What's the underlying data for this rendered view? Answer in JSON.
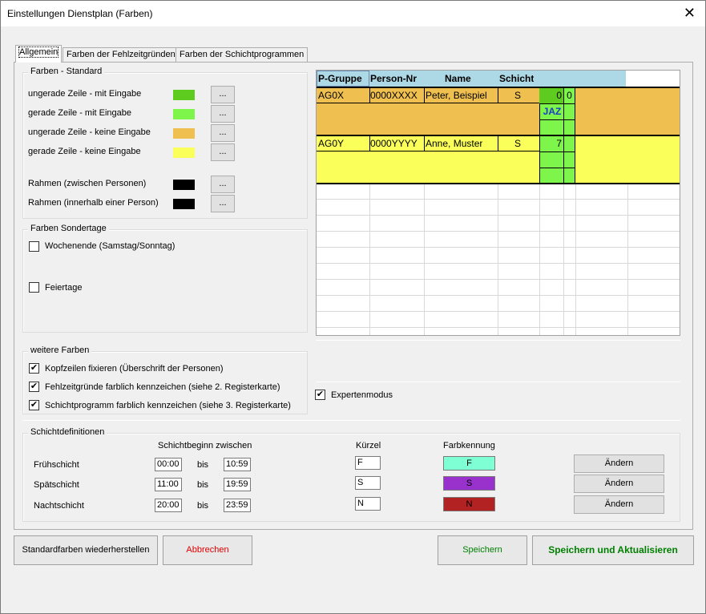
{
  "window": {
    "title": "Einstellungen Dienstplan  (Farben)",
    "close_glyph": "✕"
  },
  "tabs": [
    {
      "label": "Allgemein"
    },
    {
      "label": "Farben der Fehlzeitgründen"
    },
    {
      "label": "Farben der Schichtprogrammen"
    }
  ],
  "farben_standard": {
    "title": "Farben - Standard",
    "rows": [
      {
        "label": "ungerade Zeile  - mit Eingabe",
        "color": "#5ecc1e",
        "button": "..."
      },
      {
        "label": "gerade Zeile    - mit Eingabe",
        "color": "#7ef54a",
        "button": "..."
      },
      {
        "label": "ungerade Zeile - keine Eingabe",
        "color": "#efc050",
        "button": "..."
      },
      {
        "label": "gerade Zeile    - keine Eingabe",
        "color": "#fbff5a",
        "button": "..."
      },
      {
        "label": "Rahmen (zwischen Personen)",
        "color": "#000000",
        "button": "..."
      },
      {
        "label": "Rahmen (innerhalb einer Person)",
        "color": "#000000",
        "button": "..."
      }
    ]
  },
  "farben_sondertage": {
    "title": "Farben Sondertage",
    "wochenende": {
      "label": "Wochenende (Samstag/Sonntag)",
      "checked": false
    },
    "feiertage": {
      "label": "Feiertage",
      "checked": false
    }
  },
  "weitere_farben": {
    "title": "weitere Farben",
    "items": [
      {
        "label": "Kopfzeilen fixieren (Überschrift der Personen)",
        "checked": true
      },
      {
        "label": "Fehlzeitgründe farblich kennzeichen (siehe 2. Registerkarte)",
        "checked": true
      },
      {
        "label": "Schichtprogramm farblich kennzeichen (siehe 3. Registerkarte)",
        "checked": true
      }
    ]
  },
  "expertenmodus": {
    "label": "Expertenmodus",
    "checked": true
  },
  "preview": {
    "headers": [
      "P-Gruppe",
      "Person-Nr",
      "Name",
      "Schicht"
    ],
    "persons": [
      {
        "gruppe": "AG0X",
        "nr": "0000XXXX",
        "name": "Peter, Beispiel",
        "schicht": "S",
        "val1": "0",
        "val2": "0",
        "extra": "JAZ"
      },
      {
        "gruppe": "AG0Y",
        "nr": "0000YYYY",
        "name": "Anne, Muster",
        "schicht": "S",
        "val1": "7",
        "val2": "",
        "extra": ""
      }
    ]
  },
  "schichtdefinitionen": {
    "title": "Schichtdefinitionen",
    "col_begin": "Schichtbeginn zwischen",
    "col_kuerzel": "Kürzel",
    "col_farbe": "Farbkennung",
    "bis": "bis",
    "rows": [
      {
        "name": "Frühschicht",
        "von": "00:00",
        "bis": "10:59",
        "kuerzel": "F",
        "farbe_label": "F",
        "farbe": "#7fffd4",
        "button": "Ändern"
      },
      {
        "name": "Spätschicht",
        "von": "11:00",
        "bis": "19:59",
        "kuerzel": "S",
        "farbe_label": "S",
        "farbe": "#9932cc",
        "button": "Ändern"
      },
      {
        "name": "Nachtschicht",
        "von": "20:00",
        "bis": "23:59",
        "kuerzel": "N",
        "farbe_label": "N",
        "farbe": "#b22222",
        "button": "Ändern"
      }
    ]
  },
  "buttons": {
    "standard": "Standardfarben wiederherstellen",
    "abbrechen": "Abbrechen",
    "speichern": "Speichern",
    "speichern_aktualisieren": "Speichern und Aktualisieren",
    "colors": {
      "abbrechen": "#e00000",
      "speichern": "#008000",
      "speichern_aktualisieren": "#008000"
    }
  }
}
